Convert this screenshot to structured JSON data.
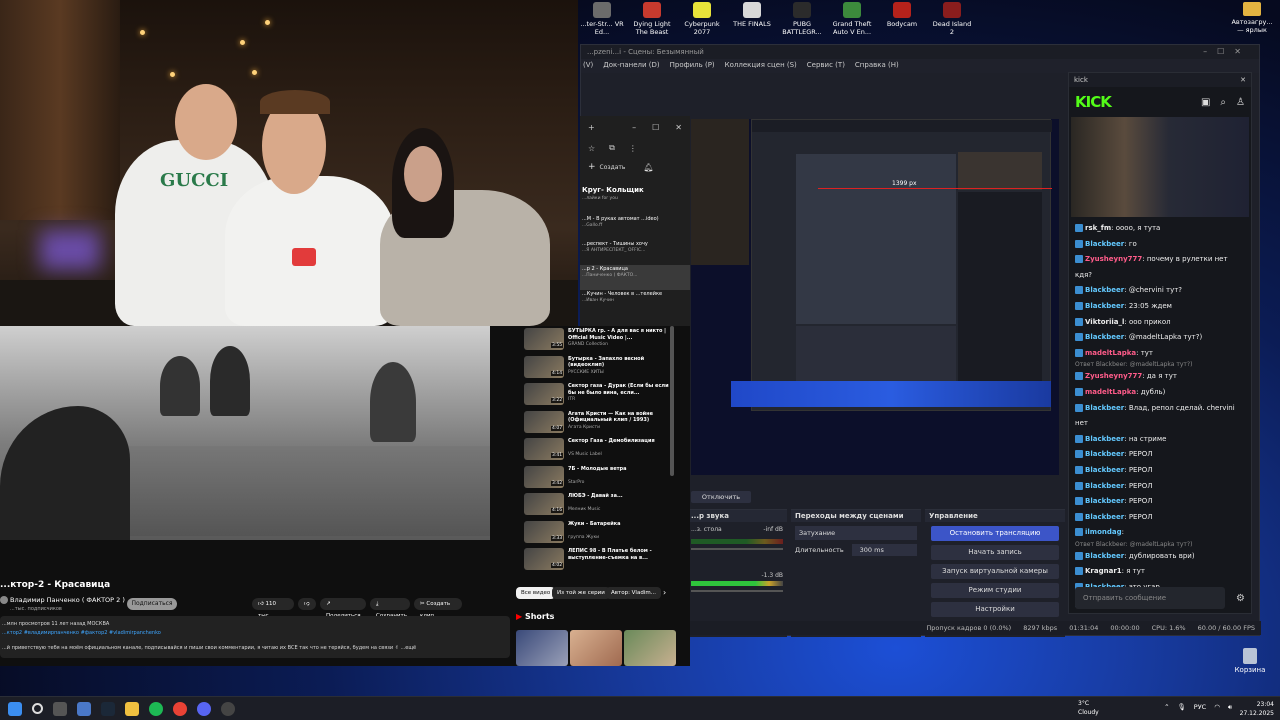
{
  "desktop": {
    "icons": [
      {
        "label": "...ter-Str... VR Ed...",
        "color": "#6b6b6b"
      },
      {
        "label": "Dying Light The Beast",
        "color": "#c73a2e"
      },
      {
        "label": "Cyberpunk 2077",
        "color": "#e8e33a"
      },
      {
        "label": "THE FINALS",
        "color": "#d8d8d8"
      },
      {
        "label": "PUBG BATTLEGR...",
        "color": "#2b2b2b"
      },
      {
        "label": "Grand Theft Auto V En...",
        "color": "#3c8a3c"
      },
      {
        "label": "Bodycam",
        "color": "#b5221b"
      },
      {
        "label": "Dead Island 2",
        "color": "#8a1d1d"
      }
    ],
    "right_icon": "Автозагру... — ярлык",
    "trash": "Корзина"
  },
  "obs": {
    "title": "...pzeni...i - Сцены: Безымянный",
    "menu": [
      "(V)",
      "Док-панели (D)",
      "Профиль (P)",
      "Коллекция сцен (S)",
      "Сервис (T)",
      "Справка (H)"
    ],
    "preview_label": "1399 px",
    "docks": {
      "audio_title": "...р звука",
      "audio_tracks": [
        {
          "name": "...з. стола",
          "db": "-inf dB"
        },
        {
          "name": "",
          "db": "-1.3 dB"
        }
      ],
      "stop_button": "Отключить",
      "transitions_title": "Переходы между сценами",
      "transition_value": "Затухание",
      "duration_label": "Длительность",
      "duration_value": "300 ms",
      "controls_title": "Управление",
      "controls": [
        "Остановить трансляцию",
        "Начать запись",
        "Запуск виртуальной камеры",
        "Режим студии",
        "Настройки"
      ]
    },
    "status": {
      "dropped": "Пропуск кадров 0 (0.0%)",
      "bitrate": "8297 kbps",
      "stream_time": "01:31:04",
      "rec_time": "00:00:00",
      "cpu": "CPU: 1.6%",
      "fps": "60.00 / 60.00 FPS"
    }
  },
  "kick": {
    "window_title": "kick",
    "logo": "KICK",
    "messages": [
      {
        "user": "rsk_fm",
        "text": "оооо, я тута",
        "style": "u3",
        "reply": ""
      },
      {
        "user": "Blackbeer",
        "text": "го",
        "style": "u",
        "reply": ""
      },
      {
        "user": "Zyusheyny777",
        "text": "почему в рулетки нет кдя?",
        "style": "u2",
        "reply": ""
      },
      {
        "user": "Blackbeer",
        "text": "@chervini тут?",
        "style": "u",
        "reply": ""
      },
      {
        "user": "Blackbeer",
        "text": "23:05 ждем",
        "style": "u",
        "reply": ""
      },
      {
        "user": "Viktoriia_l",
        "text": "ооо прикол",
        "style": "u3",
        "reply": ""
      },
      {
        "user": "Blackbeer",
        "text": "@madeltLapka тут?)",
        "style": "u",
        "reply": ""
      },
      {
        "user": "madeltLapka",
        "text": "тут",
        "style": "u2",
        "reply": ""
      },
      {
        "user": "Zyusheyny777",
        "text": "да я тут",
        "style": "u2",
        "reply": "Ответ Blackbeer: @madeltLapka тут?)"
      },
      {
        "user": "madeltLapka",
        "text": "дубль)",
        "style": "u2",
        "reply": ""
      },
      {
        "user": "Blackbeer",
        "text": "Влад, репол сделай. chervini нет",
        "style": "u",
        "reply": ""
      },
      {
        "user": "Blackbeer",
        "text": "на стриме",
        "style": "u",
        "reply": ""
      },
      {
        "user": "Blackbeer",
        "text": "РЕРОЛ",
        "style": "u",
        "reply": ""
      },
      {
        "user": "Blackbeer",
        "text": "РЕРОЛ",
        "style": "u",
        "reply": ""
      },
      {
        "user": "Blackbeer",
        "text": "РЕРОЛ",
        "style": "u",
        "reply": ""
      },
      {
        "user": "Blackbeer",
        "text": "РЕРОЛ",
        "style": "u",
        "reply": ""
      },
      {
        "user": "Blackbeer",
        "text": "РЕРОЛ",
        "style": "u",
        "reply": ""
      },
      {
        "user": "ilmondag",
        "text": "",
        "style": "u",
        "reply": ""
      },
      {
        "user": "Blackbeer",
        "text": "дублировать ври)",
        "style": "u",
        "reply": "Ответ Blackbeer: @madeltLapka тут?)"
      },
      {
        "user": "Kragnar1",
        "text": "я тут",
        "style": "u3",
        "reply": ""
      },
      {
        "user": "Blackbeer",
        "text": "это угар",
        "style": "u",
        "reply": ""
      },
      {
        "user": "Kragnar1",
        "text": "Я тут",
        "style": "u3",
        "reply": ""
      }
    ],
    "input_placeholder": "Отправить сообщение"
  },
  "playlist": {
    "header": "Круг- Кольщик",
    "sub": "...лайки for you",
    "create": "Создать",
    "items": [
      {
        "title": "...M - В руках автомат ...ideo)",
        "channel": "...Gallo.ff",
        "sel": false
      },
      {
        "title": "...респект - Тишины хочу",
        "channel": "...Я АНТИРЕСПЕКТ_ OFFIC...",
        "sel": false
      },
      {
        "title": "...р 2 - Красавица",
        "channel": "...Паниченко ( ФАКТО...",
        "sel": true
      },
      {
        "title": "...Кучин - Человек в ...телейке",
        "channel": "...Иван Кучин",
        "sel": false
      }
    ]
  },
  "youtube": {
    "title": "...ктор-2 - Красавица",
    "channel": "Владимир Панченко ( ФАКТОР 2 )",
    "subs": "...тыс. подписчиков",
    "subscribe": "Подписаться",
    "actions": [
      {
        "label": "110 тыс.",
        "icon": "like-icon"
      },
      {
        "label": "",
        "icon": "dislike-icon"
      },
      {
        "label": "Поделиться",
        "icon": "share-icon"
      },
      {
        "label": "Сохранить",
        "icon": "download-icon"
      },
      {
        "label": "Создать клип",
        "icon": "clip-icon"
      }
    ],
    "desc_line1": "...млн просмотров  11 лет назад  МОСКВА",
    "desc_tags": "...ктор2 #владимирпанченко #фактор2 #vladimirpanchenko",
    "desc_line2": "...й приветствую тебя на моём официальном канале, подписывайся и пиши свои комментарии, я читаю их ВСЕ так что не теряйся, будем на связи ✌ ...ещё",
    "related": [
      {
        "title": "БУТЫРКА гр. - А для вас я никто | Official Music Video |...",
        "channel": "GRAND Collection",
        "dur": "3:55"
      },
      {
        "title": "Бутырка - Запахло весной (видеоклип)",
        "channel": "РУССКИЕ ХИТЫ",
        "dur": "4:14"
      },
      {
        "title": "Сектор газа - Дурак (Если бы если бы не было вина, если...",
        "channel": "ITR",
        "dur": "3:22"
      },
      {
        "title": "Агата Кристи — Как на войне (Официальный клип / 1993)",
        "channel": "Агата Кристи",
        "dur": "4:07"
      },
      {
        "title": "Сектор Газа - Демобилизация",
        "channel": "VS Music Label",
        "dur": "3:41"
      },
      {
        "title": "7Б - Молодые ветра",
        "channel": "StarPro",
        "dur": "3:42"
      },
      {
        "title": "ЛЮБЭ - Давай за...",
        "channel": "Мелник Music",
        "dur": "4:16"
      },
      {
        "title": "Жуки - Батарейка",
        "channel": "группа Жуки",
        "dur": "3:33"
      },
      {
        "title": "ЛЕПИС 98 - В Платье белом - выступление-съемка на в...",
        "channel": "",
        "dur": "4:02"
      }
    ],
    "chips": [
      "Все видео",
      "Из той же серии",
      "Автор: Vladim..."
    ],
    "shorts_label": "Shorts"
  },
  "taskbar": {
    "weather_temp": "3°C",
    "weather_desc": "Cloudy",
    "lang": "РУС",
    "time": "23:04",
    "date": "27.12.2025"
  }
}
